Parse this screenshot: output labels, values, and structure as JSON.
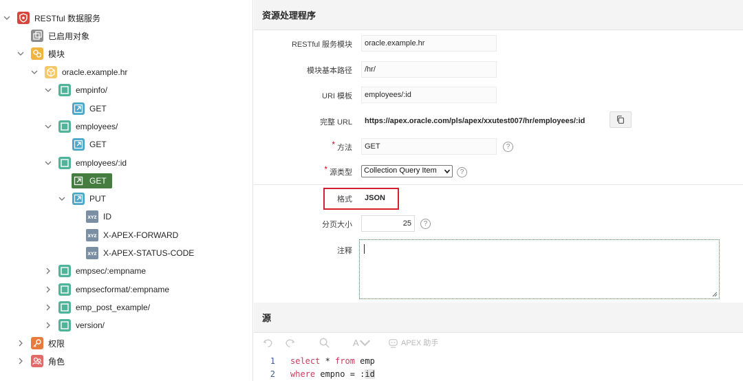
{
  "tree": {
    "root": "RESTful 数据服务",
    "enabled_objects": "已启用对象",
    "modules": "模块",
    "module_name": "oracle.example.hr",
    "templates": [
      {
        "name": "empinfo/",
        "handlers": [
          "GET"
        ]
      },
      {
        "name": "employees/",
        "handlers": [
          "GET"
        ]
      },
      {
        "name": "employees/:id",
        "handlers": [
          "GET",
          "PUT"
        ],
        "params": [
          "ID",
          "X-APEX-FORWARD",
          "X-APEX-STATUS-CODE"
        ]
      },
      {
        "name": "empsec/:empname"
      },
      {
        "name": "empsecformat/:empname"
      },
      {
        "name": "emp_post_example/"
      },
      {
        "name": "version/"
      }
    ],
    "privileges": "权限",
    "roles": "角色",
    "param_badge": "XYZ"
  },
  "panel": {
    "title": "资源处理程序",
    "fields": {
      "module_label": "RESTful 服务模块",
      "module_value": "oracle.example.hr",
      "base_path_label": "模块基本路径",
      "base_path_value": "/hr/",
      "uri_label": "URI 模板",
      "uri_value": "employees/:id",
      "full_url_label": "完整 URL",
      "full_url_value": "https://apex.oracle.com/pls/apex/xxutest007/hr/employees/:id",
      "method_label": "方法",
      "method_value": "GET",
      "source_type_label": "源类型",
      "source_type_value": "Collection Query Item",
      "format_label": "格式",
      "format_value": "JSON",
      "page_size_label": "分页大小",
      "page_size_value": "25",
      "comment_label": "注释",
      "required_mark": "*",
      "help_glyph": "?"
    },
    "source": {
      "title": "源",
      "apex_assist": "APEX 助手",
      "font_btn": "A",
      "lines": [
        {
          "num": "1",
          "kw1": "select",
          "t1": " * ",
          "kw2": "from",
          "t2": " emp",
          "t3": ""
        },
        {
          "num": "2",
          "kw1": "where",
          "t1": " empno = :",
          "kw2": "",
          "t2": "",
          "t3": "id"
        }
      ]
    }
  },
  "colors": {
    "accent_green": "#447d3f",
    "highlight_red": "#d0212f",
    "keyword": "#c73b5d"
  }
}
